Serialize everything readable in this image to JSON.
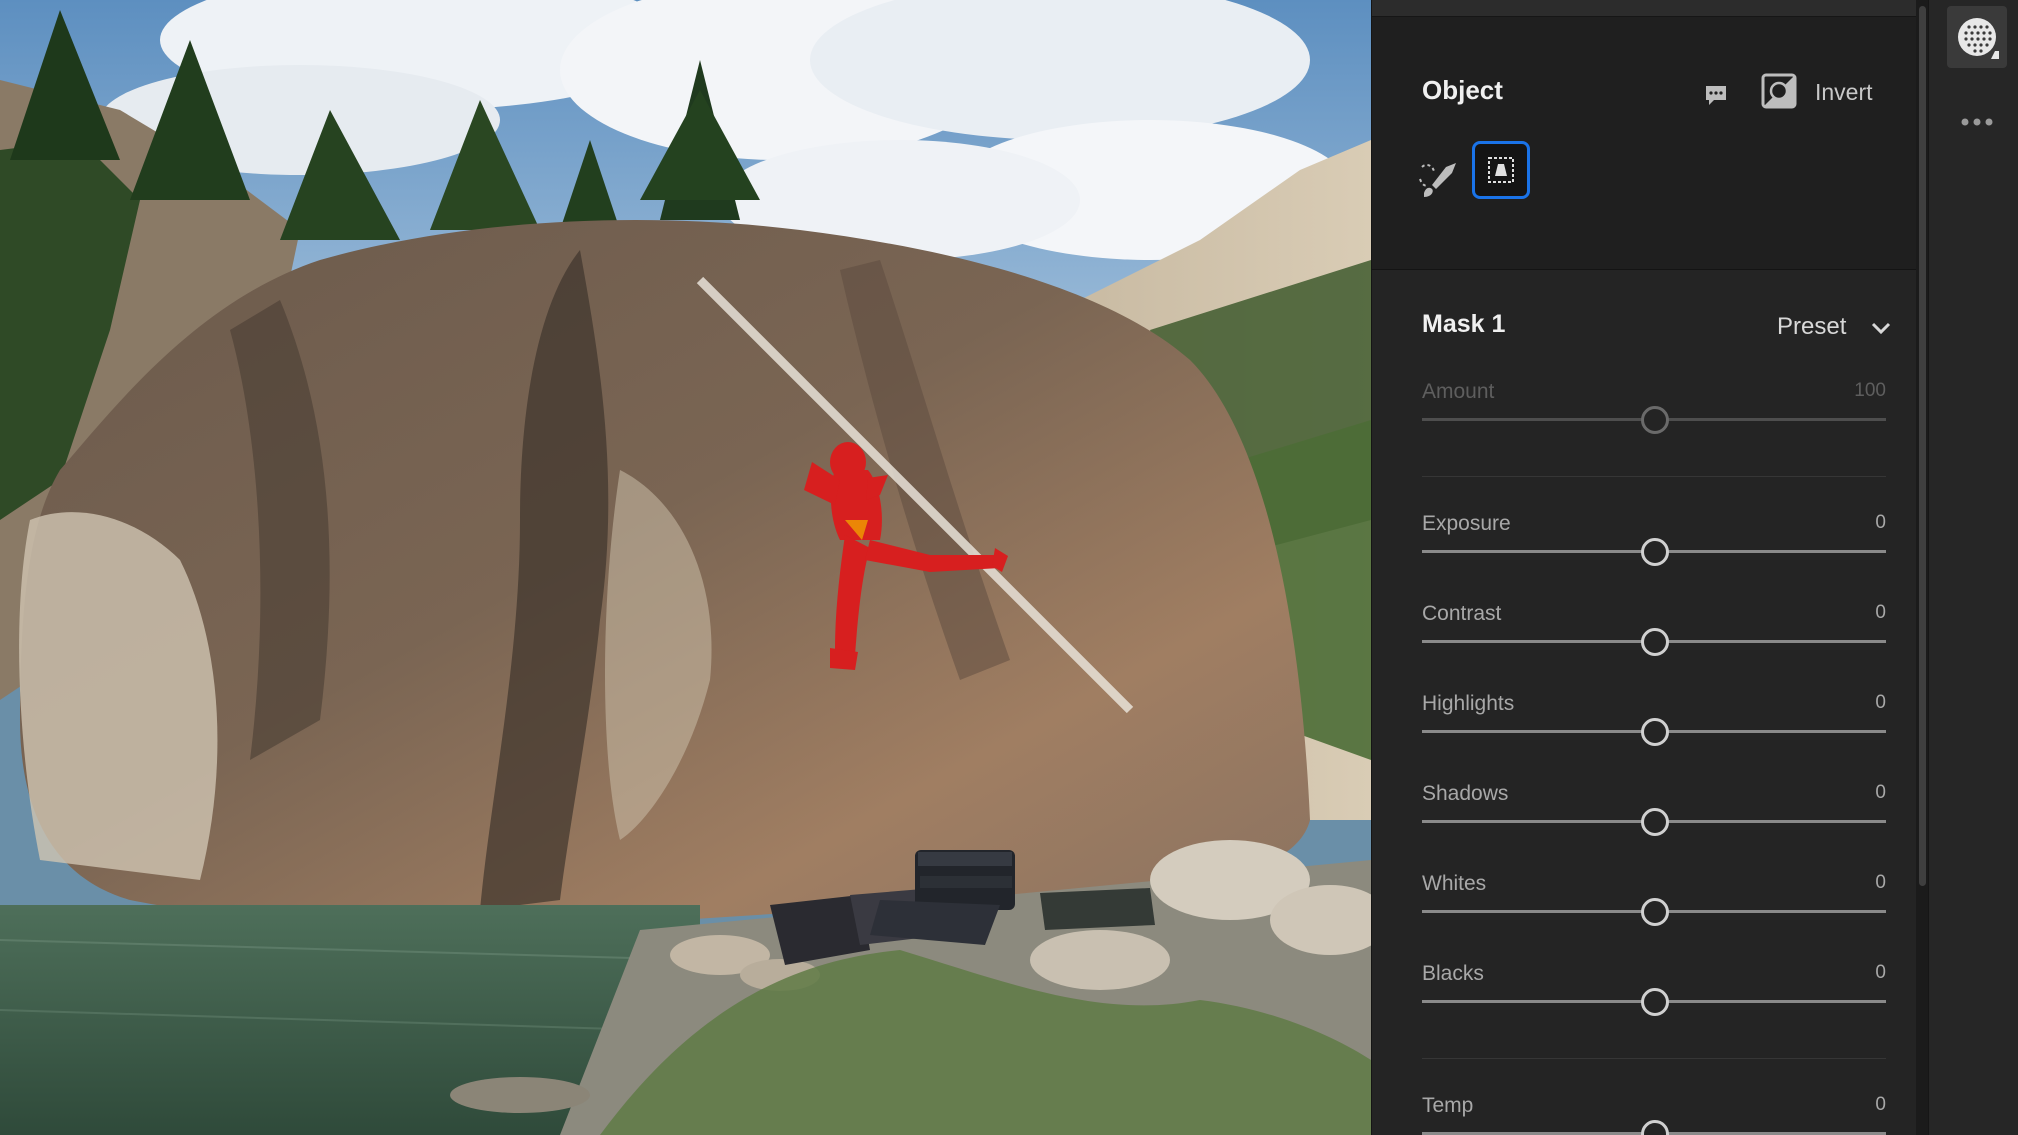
{
  "object_panel": {
    "title": "Object",
    "invert_label": "Invert",
    "icons": {
      "comment": "comment-icon",
      "invert": "invert-icon",
      "brush": "brush-select-icon",
      "rectangle": "rectangle-select-icon"
    }
  },
  "mask_panel": {
    "title": "Mask 1",
    "preset_label": "Preset",
    "sliders": [
      {
        "label": "Amount",
        "value": "100",
        "position": 0.5,
        "disabled": true
      },
      {
        "label": "Exposure",
        "value": "0",
        "position": 0.5,
        "disabled": false
      },
      {
        "label": "Contrast",
        "value": "0",
        "position": 0.5,
        "disabled": false
      },
      {
        "label": "Highlights",
        "value": "0",
        "position": 0.5,
        "disabled": false
      },
      {
        "label": "Shadows",
        "value": "0",
        "position": 0.5,
        "disabled": false
      },
      {
        "label": "Whites",
        "value": "0",
        "position": 0.5,
        "disabled": false
      },
      {
        "label": "Blacks",
        "value": "0",
        "position": 0.5,
        "disabled": false
      },
      {
        "label": "Temp",
        "value": "0",
        "position": 0.5,
        "disabled": false
      }
    ]
  },
  "colors": {
    "accent": "#1a73e8",
    "mask_overlay": "#d71f1f",
    "panel_bg": "#242424"
  }
}
